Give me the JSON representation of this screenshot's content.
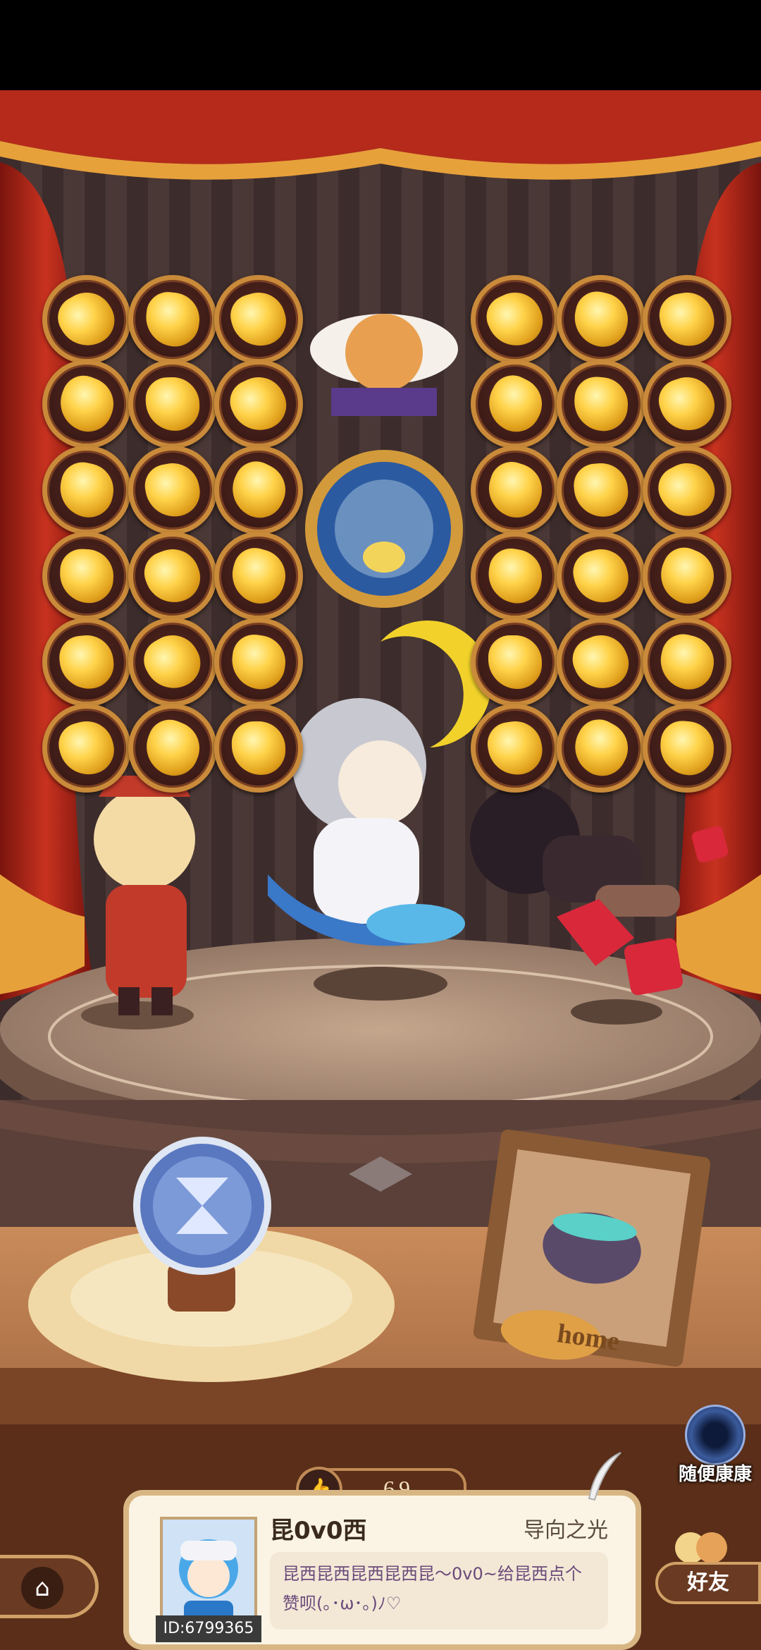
{
  "likes": {
    "count": "69"
  },
  "profile": {
    "name": "昆0v0西",
    "id": "ID:6799365",
    "title": "导向之光",
    "bio": "昆西昆西昆西昆西昆～0v0~给昆西点个赞呗(｡･ω･｡)ﾉ♡"
  },
  "random_visit": {
    "label": "随便康康"
  },
  "friends": {
    "label": "好友"
  },
  "home_frame": {
    "label": "home"
  },
  "colors": {
    "curtain": "#b0261a",
    "gold": "#ffd34a",
    "wood": "#8a4a2a"
  }
}
